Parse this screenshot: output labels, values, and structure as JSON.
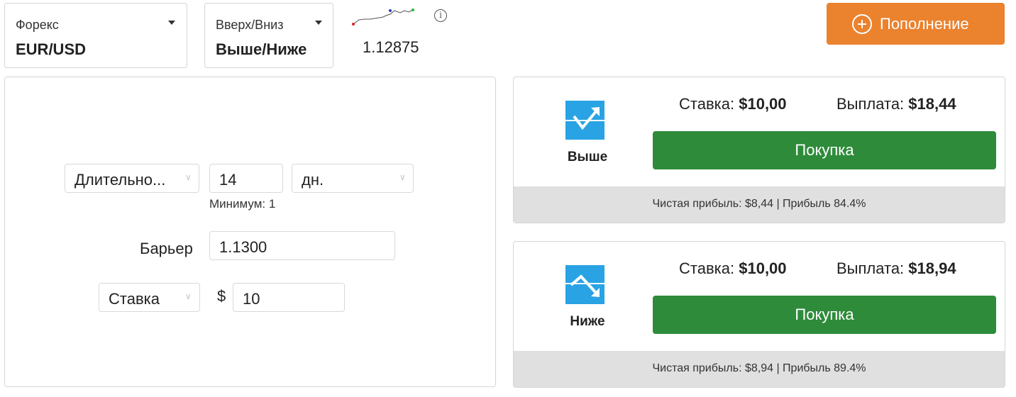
{
  "market": {
    "label": "Форекс",
    "value": "EUR/USD"
  },
  "trade_type": {
    "label": "Вверх/Вниз",
    "value": "Выше/Ниже"
  },
  "spot": {
    "price": "1.12875"
  },
  "info_icon": "info-icon",
  "deposit": {
    "label": "Пополнение",
    "color": "#ea822e"
  },
  "params": {
    "duration_label": "Длительно...",
    "duration_value": "14",
    "duration_unit": "дн.",
    "min_note": "Минимум: 1",
    "barrier_label": "Барьер",
    "barrier_value": "1.1300",
    "stake_label": "Ставка",
    "currency_symbol": "$",
    "stake_value": "10"
  },
  "contracts": [
    {
      "name": "Выше",
      "icon": "higher-arrow-icon",
      "stake_label": "Ставка:",
      "stake_amount": "$10,00",
      "payout_label": "Выплата:",
      "payout_amount": "$18,44",
      "buy_label": "Покупка",
      "footer": "Чистая прибыль: $8,44 | Прибыль 84.4%"
    },
    {
      "name": "Ниже",
      "icon": "lower-arrow-icon",
      "stake_label": "Ставка:",
      "stake_amount": "$10,00",
      "payout_label": "Выплата:",
      "payout_amount": "$18,94",
      "buy_label": "Покупка",
      "footer": "Чистая прибыль: $8,94 | Прибыль 89.4%"
    }
  ],
  "colors": {
    "buy_button": "#2e8b3a",
    "icon_bg": "#29a3e3",
    "footer_bg": "#e0e0e0"
  }
}
